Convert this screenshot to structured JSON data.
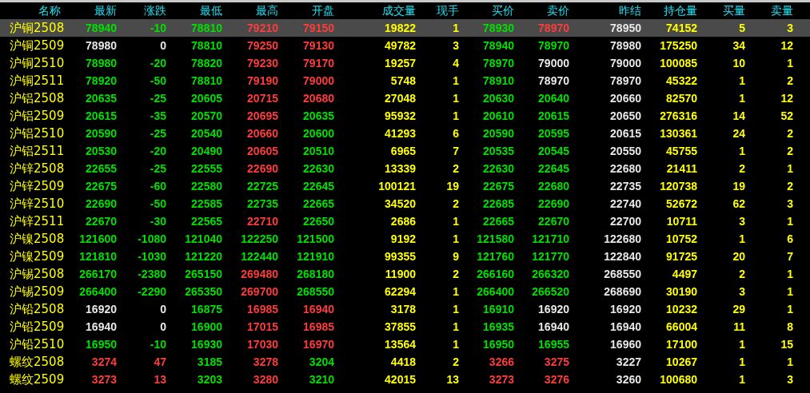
{
  "columns": [
    {
      "label": "名称",
      "kind": "name"
    },
    {
      "label": "最新",
      "kind": "price"
    },
    {
      "label": "涨跌",
      "kind": "price"
    },
    {
      "label": "最低",
      "kind": "price"
    },
    {
      "label": "最高",
      "kind": "price"
    },
    {
      "label": "开盘",
      "kind": "price"
    },
    {
      "label": "成交量",
      "kind": "volume"
    },
    {
      "label": "现手",
      "kind": "volume"
    },
    {
      "label": "买价",
      "kind": "price"
    },
    {
      "label": "卖价",
      "kind": "price"
    },
    {
      "label": "昨结",
      "kind": "reference"
    },
    {
      "label": "持仓量",
      "kind": "volume"
    },
    {
      "label": "买量",
      "kind": "volume"
    },
    {
      "label": "卖量",
      "kind": "volume"
    }
  ],
  "rows": [
    {
      "selected": true,
      "cells": [
        "沪铜2508",
        {
          "text": "78940",
          "color": "#00e000"
        },
        {
          "text": "-10",
          "color": "#00e000"
        },
        {
          "text": "78810",
          "color": "#00e000"
        },
        {
          "text": "79210",
          "color": "#ff3c3c"
        },
        {
          "text": "79150",
          "color": "#ff3c3c"
        },
        "19822",
        "1",
        {
          "text": "78930",
          "color": "#00e000"
        },
        {
          "text": "78970",
          "color": "#ff3c3c"
        },
        "78950",
        "74152",
        "5",
        "3"
      ]
    },
    {
      "selected": false,
      "cells": [
        "沪铜2509",
        {
          "text": "78980",
          "color": "#e8e8e8"
        },
        {
          "text": "0",
          "color": "#e8e8e8"
        },
        {
          "text": "78810",
          "color": "#00e000"
        },
        {
          "text": "79250",
          "color": "#ff3c3c"
        },
        {
          "text": "79130",
          "color": "#ff3c3c"
        },
        "49782",
        "3",
        {
          "text": "78940",
          "color": "#00e000"
        },
        {
          "text": "78970",
          "color": "#00e000"
        },
        "78980",
        "175250",
        "34",
        "12"
      ]
    },
    {
      "selected": false,
      "cells": [
        "沪铜2510",
        {
          "text": "78980",
          "color": "#00e000"
        },
        {
          "text": "-20",
          "color": "#00e000"
        },
        {
          "text": "78820",
          "color": "#00e000"
        },
        {
          "text": "79230",
          "color": "#ff3c3c"
        },
        {
          "text": "79170",
          "color": "#ff3c3c"
        },
        "19257",
        "4",
        {
          "text": "78970",
          "color": "#00e000"
        },
        {
          "text": "79000",
          "color": "#e8e8e8"
        },
        "79000",
        "100085",
        "10",
        "1"
      ]
    },
    {
      "selected": false,
      "cells": [
        "沪铜2511",
        {
          "text": "78920",
          "color": "#00e000"
        },
        {
          "text": "-50",
          "color": "#00e000"
        },
        {
          "text": "78810",
          "color": "#00e000"
        },
        {
          "text": "79190",
          "color": "#ff3c3c"
        },
        {
          "text": "79000",
          "color": "#ff3c3c"
        },
        "5748",
        "1",
        {
          "text": "78910",
          "color": "#00e000"
        },
        {
          "text": "78970",
          "color": "#e8e8e8"
        },
        "78970",
        "45322",
        "1",
        "2"
      ]
    },
    {
      "selected": false,
      "cells": [
        "沪铝2508",
        {
          "text": "20635",
          "color": "#00e000"
        },
        {
          "text": "-25",
          "color": "#00e000"
        },
        {
          "text": "20605",
          "color": "#00e000"
        },
        {
          "text": "20715",
          "color": "#ff3c3c"
        },
        {
          "text": "20680",
          "color": "#ff3c3c"
        },
        "27048",
        "1",
        {
          "text": "20630",
          "color": "#00e000"
        },
        {
          "text": "20640",
          "color": "#00e000"
        },
        "20660",
        "82570",
        "1",
        "12"
      ]
    },
    {
      "selected": false,
      "cells": [
        "沪铝2509",
        {
          "text": "20615",
          "color": "#00e000"
        },
        {
          "text": "-35",
          "color": "#00e000"
        },
        {
          "text": "20570",
          "color": "#00e000"
        },
        {
          "text": "20695",
          "color": "#ff3c3c"
        },
        {
          "text": "20635",
          "color": "#00e000"
        },
        "95932",
        "1",
        {
          "text": "20610",
          "color": "#00e000"
        },
        {
          "text": "20615",
          "color": "#00e000"
        },
        "20650",
        "276316",
        "14",
        "52"
      ]
    },
    {
      "selected": false,
      "cells": [
        "沪铝2510",
        {
          "text": "20590",
          "color": "#00e000"
        },
        {
          "text": "-25",
          "color": "#00e000"
        },
        {
          "text": "20540",
          "color": "#00e000"
        },
        {
          "text": "20660",
          "color": "#ff3c3c"
        },
        {
          "text": "20600",
          "color": "#00e000"
        },
        "41293",
        "6",
        {
          "text": "20590",
          "color": "#00e000"
        },
        {
          "text": "20595",
          "color": "#00e000"
        },
        "20615",
        "130361",
        "24",
        "2"
      ]
    },
    {
      "selected": false,
      "cells": [
        "沪铝2511",
        {
          "text": "20530",
          "color": "#00e000"
        },
        {
          "text": "-20",
          "color": "#00e000"
        },
        {
          "text": "20490",
          "color": "#00e000"
        },
        {
          "text": "20605",
          "color": "#ff3c3c"
        },
        {
          "text": "20510",
          "color": "#00e000"
        },
        "6965",
        "7",
        {
          "text": "20535",
          "color": "#00e000"
        },
        {
          "text": "20545",
          "color": "#00e000"
        },
        "20550",
        "45755",
        "1",
        "2"
      ]
    },
    {
      "selected": false,
      "cells": [
        "沪锌2508",
        {
          "text": "22655",
          "color": "#00e000"
        },
        {
          "text": "-25",
          "color": "#00e000"
        },
        {
          "text": "22555",
          "color": "#00e000"
        },
        {
          "text": "22690",
          "color": "#ff3c3c"
        },
        {
          "text": "22630",
          "color": "#00e000"
        },
        "13339",
        "2",
        {
          "text": "22630",
          "color": "#00e000"
        },
        {
          "text": "22645",
          "color": "#00e000"
        },
        "22680",
        "21411",
        "2",
        "1"
      ]
    },
    {
      "selected": false,
      "cells": [
        "沪锌2509",
        {
          "text": "22675",
          "color": "#00e000"
        },
        {
          "text": "-60",
          "color": "#00e000"
        },
        {
          "text": "22580",
          "color": "#00e000"
        },
        {
          "text": "22725",
          "color": "#00e000"
        },
        {
          "text": "22645",
          "color": "#00e000"
        },
        "100121",
        "19",
        {
          "text": "22675",
          "color": "#00e000"
        },
        {
          "text": "22680",
          "color": "#00e000"
        },
        "22735",
        "120738",
        "19",
        "2"
      ]
    },
    {
      "selected": false,
      "cells": [
        "沪锌2510",
        {
          "text": "22690",
          "color": "#00e000"
        },
        {
          "text": "-50",
          "color": "#00e000"
        },
        {
          "text": "22585",
          "color": "#00e000"
        },
        {
          "text": "22735",
          "color": "#00e000"
        },
        {
          "text": "22665",
          "color": "#00e000"
        },
        "34520",
        "2",
        {
          "text": "22685",
          "color": "#00e000"
        },
        {
          "text": "22690",
          "color": "#00e000"
        },
        "22740",
        "52672",
        "62",
        "3"
      ]
    },
    {
      "selected": false,
      "cells": [
        "沪锌2511",
        {
          "text": "22670",
          "color": "#00e000"
        },
        {
          "text": "-30",
          "color": "#00e000"
        },
        {
          "text": "22565",
          "color": "#00e000"
        },
        {
          "text": "22710",
          "color": "#ff3c3c"
        },
        {
          "text": "22650",
          "color": "#00e000"
        },
        "2686",
        "1",
        {
          "text": "22665",
          "color": "#00e000"
        },
        {
          "text": "22670",
          "color": "#00e000"
        },
        "22700",
        "10711",
        "3",
        "1"
      ]
    },
    {
      "selected": false,
      "cells": [
        "沪镍2508",
        {
          "text": "121600",
          "color": "#00e000"
        },
        {
          "text": "-1080",
          "color": "#00e000"
        },
        {
          "text": "121040",
          "color": "#00e000"
        },
        {
          "text": "122250",
          "color": "#00e000"
        },
        {
          "text": "121500",
          "color": "#00e000"
        },
        "9192",
        "1",
        {
          "text": "121580",
          "color": "#00e000"
        },
        {
          "text": "121710",
          "color": "#00e000"
        },
        "122680",
        "10752",
        "1",
        "6"
      ]
    },
    {
      "selected": false,
      "cells": [
        "沪镍2509",
        {
          "text": "121810",
          "color": "#00e000"
        },
        {
          "text": "-1030",
          "color": "#00e000"
        },
        {
          "text": "121220",
          "color": "#00e000"
        },
        {
          "text": "122440",
          "color": "#00e000"
        },
        {
          "text": "121910",
          "color": "#00e000"
        },
        "99355",
        "9",
        {
          "text": "121760",
          "color": "#00e000"
        },
        {
          "text": "121770",
          "color": "#00e000"
        },
        "122840",
        "91725",
        "20",
        "7"
      ]
    },
    {
      "selected": false,
      "cells": [
        "沪锡2508",
        {
          "text": "266170",
          "color": "#00e000"
        },
        {
          "text": "-2380",
          "color": "#00e000"
        },
        {
          "text": "265150",
          "color": "#00e000"
        },
        {
          "text": "269480",
          "color": "#ff3c3c"
        },
        {
          "text": "268180",
          "color": "#00e000"
        },
        "11900",
        "2",
        {
          "text": "266160",
          "color": "#00e000"
        },
        {
          "text": "266320",
          "color": "#00e000"
        },
        "268550",
        "4497",
        "2",
        "1"
      ]
    },
    {
      "selected": false,
      "cells": [
        "沪锡2509",
        {
          "text": "266400",
          "color": "#00e000"
        },
        {
          "text": "-2290",
          "color": "#00e000"
        },
        {
          "text": "265350",
          "color": "#00e000"
        },
        {
          "text": "269700",
          "color": "#ff3c3c"
        },
        {
          "text": "268550",
          "color": "#00e000"
        },
        "62294",
        "1",
        {
          "text": "266400",
          "color": "#00e000"
        },
        {
          "text": "266520",
          "color": "#00e000"
        },
        "268690",
        "30190",
        "3",
        "1"
      ]
    },
    {
      "selected": false,
      "cells": [
        "沪铅2508",
        {
          "text": "16920",
          "color": "#e8e8e8"
        },
        {
          "text": "0",
          "color": "#e8e8e8"
        },
        {
          "text": "16875",
          "color": "#00e000"
        },
        {
          "text": "16985",
          "color": "#ff3c3c"
        },
        {
          "text": "16940",
          "color": "#ff3c3c"
        },
        "3178",
        "1",
        {
          "text": "16910",
          "color": "#00e000"
        },
        {
          "text": "16920",
          "color": "#e8e8e8"
        },
        "16920",
        "10232",
        "29",
        "1"
      ]
    },
    {
      "selected": false,
      "cells": [
        "沪铅2509",
        {
          "text": "16940",
          "color": "#e8e8e8"
        },
        {
          "text": "0",
          "color": "#e8e8e8"
        },
        {
          "text": "16900",
          "color": "#00e000"
        },
        {
          "text": "17015",
          "color": "#ff3c3c"
        },
        {
          "text": "16985",
          "color": "#ff3c3c"
        },
        "37855",
        "1",
        {
          "text": "16935",
          "color": "#00e000"
        },
        {
          "text": "16940",
          "color": "#e8e8e8"
        },
        "16940",
        "66004",
        "11",
        "8"
      ]
    },
    {
      "selected": false,
      "cells": [
        "沪铅2510",
        {
          "text": "16950",
          "color": "#00e000"
        },
        {
          "text": "-10",
          "color": "#00e000"
        },
        {
          "text": "16930",
          "color": "#00e000"
        },
        {
          "text": "17030",
          "color": "#ff3c3c"
        },
        {
          "text": "16970",
          "color": "#ff3c3c"
        },
        "13564",
        "1",
        {
          "text": "16950",
          "color": "#00e000"
        },
        {
          "text": "16955",
          "color": "#00e000"
        },
        "16960",
        "17100",
        "1",
        "15"
      ]
    },
    {
      "selected": false,
      "cells": [
        "螺纹2508",
        {
          "text": "3274",
          "color": "#ff3c3c"
        },
        {
          "text": "47",
          "color": "#ff3c3c"
        },
        {
          "text": "3185",
          "color": "#00e000"
        },
        {
          "text": "3278",
          "color": "#ff3c3c"
        },
        {
          "text": "3204",
          "color": "#00e000"
        },
        "4418",
        "2",
        {
          "text": "3266",
          "color": "#ff3c3c"
        },
        {
          "text": "3275",
          "color": "#ff3c3c"
        },
        "3227",
        "10267",
        "1",
        "1"
      ]
    },
    {
      "selected": false,
      "cells": [
        "螺纹2509",
        {
          "text": "3273",
          "color": "#ff3c3c"
        },
        {
          "text": "13",
          "color": "#ff3c3c"
        },
        {
          "text": "3203",
          "color": "#00e000"
        },
        {
          "text": "3280",
          "color": "#ff3c3c"
        },
        {
          "text": "3210",
          "color": "#00e000"
        },
        "42015",
        "13",
        {
          "text": "3273",
          "color": "#ff3c3c"
        },
        {
          "text": "3276",
          "color": "#ff3c3c"
        },
        "3260",
        "100680",
        "1",
        "3"
      ]
    }
  ]
}
